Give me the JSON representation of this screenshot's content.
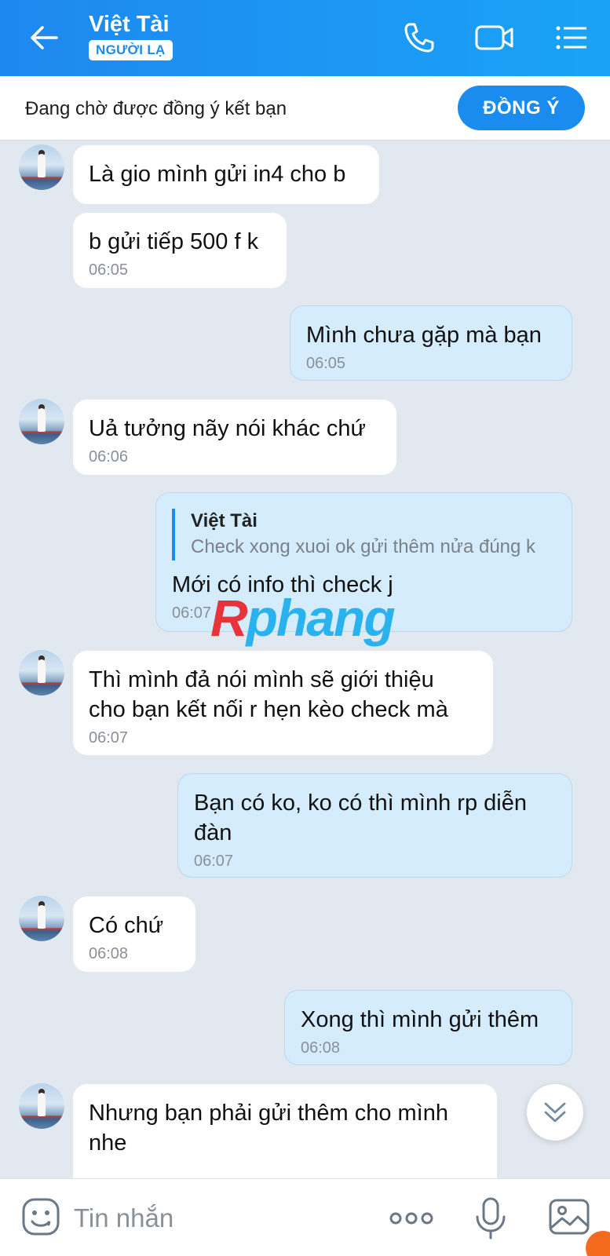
{
  "header": {
    "contact_name": "Việt Tài",
    "stranger_badge": "NGƯỜI LẠ",
    "icons": [
      "back-arrow-icon",
      "phone-icon",
      "video-camera-icon",
      "menu-list-icon"
    ]
  },
  "request_bar": {
    "text": "Đang chờ được đồng ý kết bạn",
    "accept_label": "ĐỒNG Ý"
  },
  "messages": [
    {
      "side": "incoming",
      "text": "Là gio mình gửi in4 cho b"
    },
    {
      "side": "incoming",
      "text": "b gửi tiếp 500 f k",
      "time": "06:05"
    },
    {
      "side": "outgoing",
      "text": "Mình chưa gặp mà bạn",
      "time": "06:05"
    },
    {
      "side": "incoming",
      "text": "Uả tưởng nãy nói khác chứ",
      "time": "06:06"
    },
    {
      "side": "outgoing",
      "quote_name": "Việt Tài",
      "quote_text": "Check xong xuoi ok gửi thêm nửa đúng k",
      "text": "Mới có info thì check j",
      "time": "06:07"
    },
    {
      "side": "incoming",
      "line1": "Thì mình đả nói mình sẽ giới thiệu",
      "line2": "cho bạn kết nối r hẹn kèo check mà",
      "time": "06:07"
    },
    {
      "side": "outgoing",
      "line1": "Bạn có ko, ko có thì mình rp diễn",
      "line2": "đàn",
      "time": "06:07"
    },
    {
      "side": "incoming",
      "text": "Có chứ",
      "time": "06:08"
    },
    {
      "side": "outgoing",
      "text": "Xong thì mình gửi thêm",
      "time": "06:08"
    },
    {
      "side": "incoming",
      "line1": "Nhưng bạn phải gửi thêm cho mình",
      "line2": "nhe"
    }
  ],
  "watermark": {
    "r": "R",
    "rest": "phang"
  },
  "input_bar": {
    "placeholder": "Tin nhắn",
    "icons": [
      "emoji-icon",
      "more-dots-icon",
      "microphone-icon",
      "image-icon"
    ]
  },
  "colors": {
    "accent": "#1a8cf0",
    "outgoing_bubble": "#d4ecfc",
    "chat_background": "#e2e8ef"
  }
}
